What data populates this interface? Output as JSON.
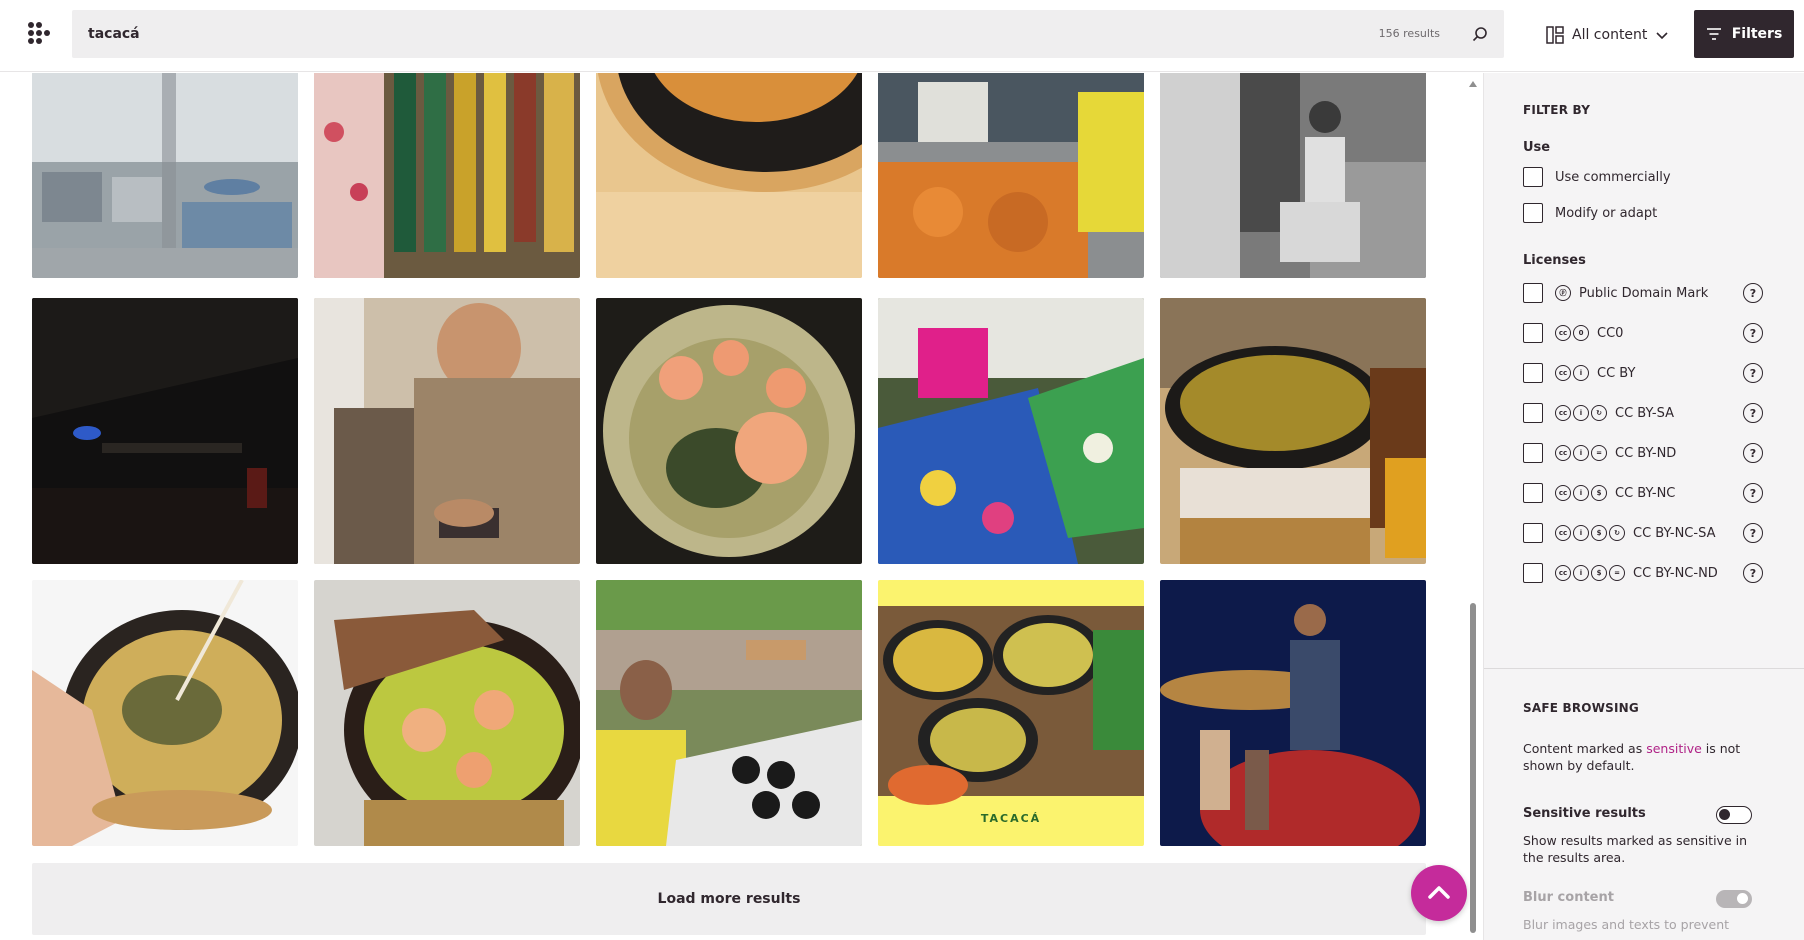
{
  "header": {
    "search_value": "tacacá",
    "result_count": "156 results",
    "content_type": "All content",
    "filters_label": "Filters"
  },
  "main": {
    "load_more_label": "Load more results",
    "photos": [
      {
        "alt": "Rainy street seen through window"
      },
      {
        "alt": "Market stall with hanging bottles"
      },
      {
        "alt": "Bowl in woven basket"
      },
      {
        "alt": "Market counter with shrimp"
      },
      {
        "alt": "Man sitting in black and white"
      },
      {
        "alt": "Dark interior at night"
      },
      {
        "alt": "Young man looking at phone"
      },
      {
        "alt": "Tacacá with shrimp"
      },
      {
        "alt": "Dancer in floral skirt"
      },
      {
        "alt": "Tacacá bowl on table"
      },
      {
        "alt": "Hand holding tacacá bowl"
      },
      {
        "alt": "Tacacá bowl held by hand"
      },
      {
        "alt": "Woman at festival stall"
      },
      {
        "alt": "Tacacá poster",
        "caption": "TACACÁ"
      },
      {
        "alt": "Dancer spinning on stage"
      }
    ]
  },
  "sidebar": {
    "filter_by_title": "FILTER BY",
    "use_title": "Use",
    "use_options": [
      "Use commercially",
      "Modify or adapt"
    ],
    "licenses_title": "Licenses",
    "licenses": [
      {
        "label": "Public Domain Mark",
        "icons": [
          "pd"
        ]
      },
      {
        "label": "CC0",
        "icons": [
          "cc",
          "zero"
        ]
      },
      {
        "label": "CC BY",
        "icons": [
          "cc",
          "by"
        ]
      },
      {
        "label": "CC BY-SA",
        "icons": [
          "cc",
          "by",
          "sa"
        ]
      },
      {
        "label": "CC BY-ND",
        "icons": [
          "cc",
          "by",
          "nd"
        ]
      },
      {
        "label": "CC BY-NC",
        "icons": [
          "cc",
          "by",
          "nc"
        ]
      },
      {
        "label": "CC BY-NC-SA",
        "icons": [
          "cc",
          "by",
          "nc",
          "sa"
        ]
      },
      {
        "label": "CC BY-NC-ND",
        "icons": [
          "cc",
          "by",
          "nc",
          "nd"
        ]
      }
    ],
    "safe_browsing_title": "SAFE BROWSING",
    "safe_text_before": "Content marked as ",
    "safe_text_link": "sensitive",
    "safe_text_after": " is not shown by default.",
    "sensitive_title": "Sensitive results",
    "sensitive_desc": "Show results marked as sensitive in the results area.",
    "blur_title": "Blur content",
    "blur_desc": "Blur images and texts to prevent"
  },
  "colors": {
    "accent": "#c52b9b",
    "dark": "#30272e"
  }
}
